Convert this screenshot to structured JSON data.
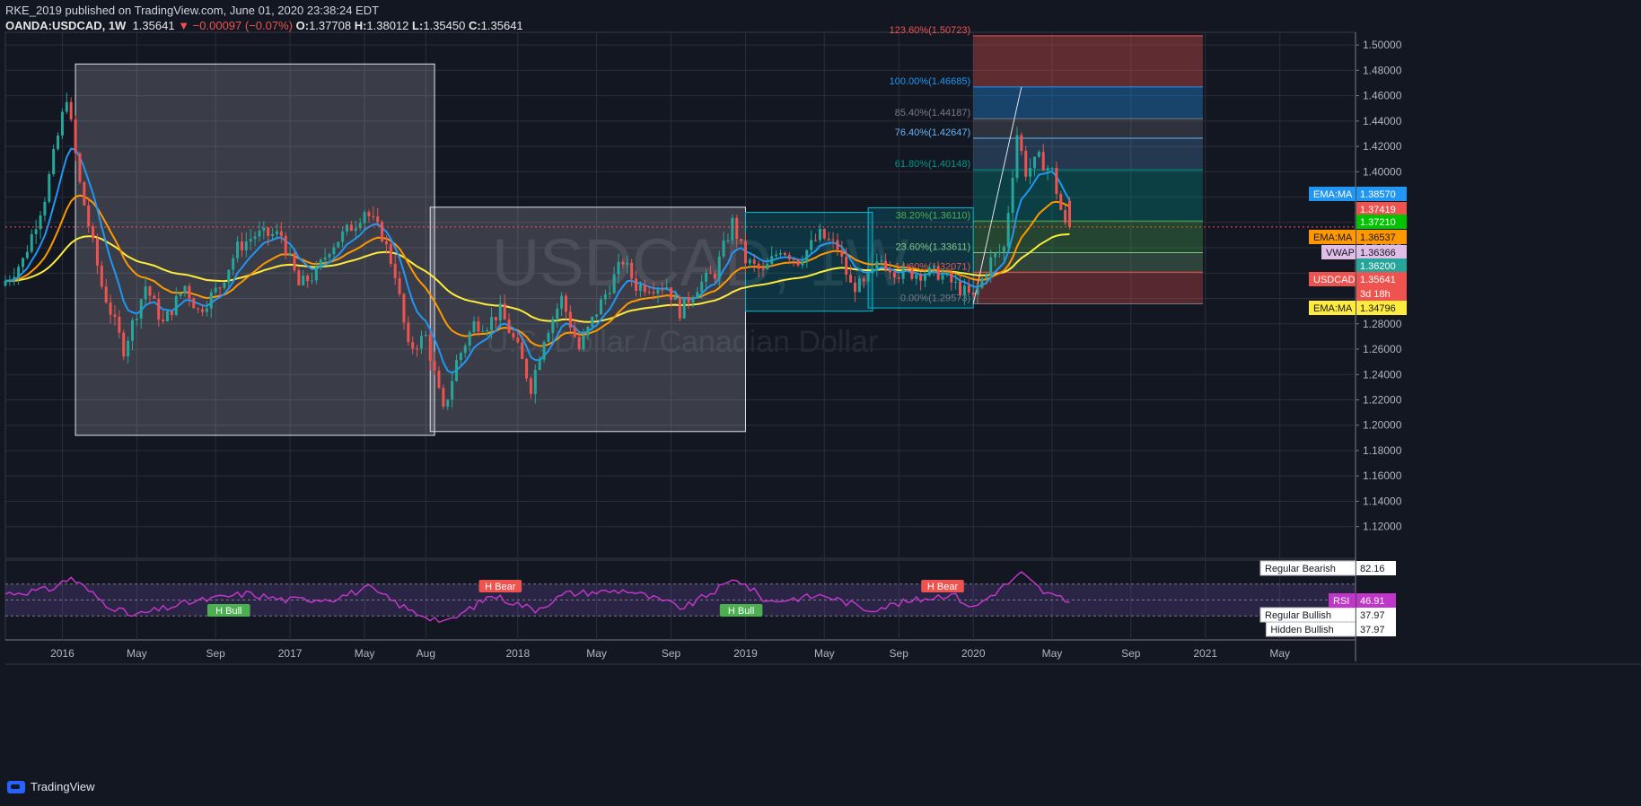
{
  "header": {
    "line1_user": "RKE_2019",
    "line1_rest": " published on TradingView.com, June 01, 2020 23:38:24 EDT",
    "symbol": "OANDA:USDCAD, 1W",
    "last": "1.35641",
    "change": "▼ −0.00097 (−0.07%)",
    "o_label": "O:",
    "o": "1.37708",
    "h_label": "H:",
    "h": "1.38012",
    "l_label": "L:",
    "l": "1.35450",
    "c_label": "C:",
    "c": "1.35641"
  },
  "brand": "TradingView",
  "watermark": {
    "symbol": "USDCAD, 1W",
    "name": "U.S. Dollar / Canadian Dollar"
  },
  "colors": {
    "background": "#131722",
    "grid": "#2a2e39",
    "up": "#26a69a",
    "down": "#ef5350",
    "ema_fast": "#2196f3",
    "ema_mid": "#ff9800",
    "ema_slow": "#ffeb3b",
    "rsi": "#c036c9"
  },
  "chart_data": {
    "type": "candlestick",
    "symbol": "OANDA:USDCAD",
    "interval": "1W",
    "ylim": [
      1.095,
      1.51
    ],
    "y_ticks": [
      "1.50000",
      "1.48000",
      "1.46000",
      "1.44000",
      "1.42000",
      "1.40000",
      "1.38000",
      "1.36000",
      "1.34000",
      "1.32000",
      "1.30000",
      "1.28000",
      "1.26000",
      "1.24000",
      "1.22000",
      "1.20000",
      "1.18000",
      "1.16000",
      "1.14000",
      "1.12000"
    ],
    "x_ticks": [
      "2016",
      "May",
      "Sep",
      "2017",
      "May",
      "Aug",
      "2018",
      "May",
      "Sep",
      "2019",
      "May",
      "Sep",
      "2020",
      "May",
      "Sep",
      "2021",
      "May"
    ],
    "price_path": [
      [
        "2015-10-05",
        1.31
      ],
      [
        "2015-11-09",
        1.33
      ],
      [
        "2015-12-14",
        1.38
      ],
      [
        "2016-01-18",
        1.46
      ],
      [
        "2016-02-08",
        1.39
      ],
      [
        "2016-03-14",
        1.31
      ],
      [
        "2016-04-18",
        1.26
      ],
      [
        "2016-05-23",
        1.31
      ],
      [
        "2016-06-20",
        1.28
      ],
      [
        "2016-07-25",
        1.31
      ],
      [
        "2016-08-15",
        1.29
      ],
      [
        "2016-09-19",
        1.31
      ],
      [
        "2016-10-17",
        1.34
      ],
      [
        "2016-11-14",
        1.35
      ],
      [
        "2016-12-26",
        1.35
      ],
      [
        "2017-01-23",
        1.31
      ],
      [
        "2017-02-20",
        1.32
      ],
      [
        "2017-03-13",
        1.34
      ],
      [
        "2017-04-24",
        1.36
      ],
      [
        "2017-05-08",
        1.37
      ],
      [
        "2017-06-05",
        1.35
      ],
      [
        "2017-06-26",
        1.32
      ],
      [
        "2017-07-17",
        1.26
      ],
      [
        "2017-08-14",
        1.27
      ],
      [
        "2017-09-11",
        1.21
      ],
      [
        "2017-10-02",
        1.25
      ],
      [
        "2017-10-30",
        1.28
      ],
      [
        "2017-11-20",
        1.28
      ],
      [
        "2017-12-11",
        1.29
      ],
      [
        "2018-01-08",
        1.26
      ],
      [
        "2018-01-29",
        1.23
      ],
      [
        "2018-02-19",
        1.27
      ],
      [
        "2018-03-19",
        1.3
      ],
      [
        "2018-04-16",
        1.26
      ],
      [
        "2018-05-14",
        1.29
      ],
      [
        "2018-06-25",
        1.33
      ],
      [
        "2018-07-16",
        1.31
      ],
      [
        "2018-08-13",
        1.31
      ],
      [
        "2018-09-03",
        1.31
      ],
      [
        "2018-09-24",
        1.29
      ],
      [
        "2018-10-22",
        1.31
      ],
      [
        "2018-11-19",
        1.32
      ],
      [
        "2018-12-17",
        1.36
      ],
      [
        "2019-01-07",
        1.33
      ],
      [
        "2019-02-04",
        1.32
      ],
      [
        "2019-03-04",
        1.34
      ],
      [
        "2019-04-01",
        1.33
      ],
      [
        "2019-05-06",
        1.35
      ],
      [
        "2019-06-03",
        1.34
      ],
      [
        "2019-06-24",
        1.31
      ],
      [
        "2019-07-15",
        1.31
      ],
      [
        "2019-08-12",
        1.33
      ],
      [
        "2019-09-09",
        1.32
      ],
      [
        "2019-10-14",
        1.32
      ],
      [
        "2019-11-11",
        1.32
      ],
      [
        "2019-12-09",
        1.31
      ],
      [
        "2020-01-06",
        1.3
      ],
      [
        "2020-02-03",
        1.33
      ],
      [
        "2020-02-24",
        1.34
      ],
      [
        "2020-03-16",
        1.43
      ],
      [
        "2020-03-30",
        1.4
      ],
      [
        "2020-04-20",
        1.41
      ],
      [
        "2020-05-11",
        1.4
      ],
      [
        "2020-05-25",
        1.37
      ],
      [
        "2020-06-01",
        1.3564
      ]
    ],
    "rsi_path": [
      [
        "2015-10-05",
        58
      ],
      [
        "2015-12-14",
        63
      ],
      [
        "2016-01-18",
        78
      ],
      [
        "2016-03-14",
        45
      ],
      [
        "2016-04-25",
        30
      ],
      [
        "2016-07-25",
        47
      ],
      [
        "2016-10-24",
        58
      ],
      [
        "2016-12-26",
        50
      ],
      [
        "2017-03-13",
        52
      ],
      [
        "2017-05-08",
        65
      ],
      [
        "2017-07-17",
        35
      ],
      [
        "2017-09-11",
        22
      ],
      [
        "2017-11-20",
        56
      ],
      [
        "2018-01-29",
        38
      ],
      [
        "2018-03-19",
        58
      ],
      [
        "2018-06-25",
        62
      ],
      [
        "2018-09-24",
        40
      ],
      [
        "2018-12-17",
        77
      ],
      [
        "2019-02-04",
        48
      ],
      [
        "2019-05-06",
        56
      ],
      [
        "2019-07-15",
        38
      ],
      [
        "2019-10-14",
        52
      ],
      [
        "2019-11-25",
        58
      ],
      [
        "2019-12-30",
        40
      ],
      [
        "2020-03-16",
        83
      ],
      [
        "2020-04-20",
        60
      ],
      [
        "2020-06-01",
        46.91
      ]
    ],
    "ema_fast_last": 1.3857,
    "ema_mid_last": 1.36537,
    "ema_slow_last": 1.34796,
    "series": [
      {
        "name": "EMA:MA",
        "value": "1.38570"
      },
      {
        "name": "EMA:MA",
        "value": "1.36537"
      },
      {
        "name": "EMA:MA",
        "value": "1.34796"
      },
      {
        "name": "VWAP",
        "value": "1.36366"
      },
      {
        "name": "USDCAD",
        "value": "1.35641"
      }
    ],
    "price_tags": [
      {
        "text": "EMA:MA",
        "value": "1.38570",
        "bg": "#2196f3",
        "fg": "#ffffff",
        "price": 1.3857
      },
      {
        "text": "",
        "value": "1.37419",
        "bg": "#ef5350",
        "fg": "#ffffff",
        "price": 1.3742
      },
      {
        "text": "",
        "value": "1.37210",
        "bg": "#00c400",
        "fg": "#ffffff",
        "price": 1.3721
      },
      {
        "text": "EMA:MA",
        "value": "1.36537",
        "bg": "#ff9800",
        "fg": "#131722",
        "price": 1.3654
      },
      {
        "text": "VWAP",
        "value": "1.36366",
        "bg": "#e1bee7",
        "fg": "#131722",
        "price": 1.3637
      },
      {
        "text": "",
        "value": "1.36200",
        "bg": "#26a69a",
        "fg": "#ffffff",
        "price": 1.362
      },
      {
        "text": "USDCAD",
        "value": "1.35641",
        "bg": "#ef5350",
        "fg": "#ffffff",
        "price": 1.3564
      },
      {
        "text": "",
        "value": "3d 18h",
        "bg": "#ef5350",
        "fg": "#ffffff",
        "price": 1.3508
      },
      {
        "text": "EMA:MA",
        "value": "1.34796",
        "bg": "#ffeb3b",
        "fg": "#131722",
        "price": 1.348
      }
    ],
    "fib": {
      "start": "2019-12-30",
      "end": "2020-12-31",
      "levels": [
        {
          "label": "123.60%(1.50723)",
          "price": 1.50723,
          "color": "#ef5350"
        },
        {
          "label": "100.00%(1.46685)",
          "price": 1.46685,
          "color": "#2196f3"
        },
        {
          "label": "85.40%(1.44187)",
          "price": 1.44187,
          "color": "#787b86"
        },
        {
          "label": "76.40%(1.42647)",
          "price": 1.42647,
          "color": "#64b5f6"
        },
        {
          "label": "61.80%(1.40148)",
          "price": 1.40148,
          "color": "#009688"
        },
        {
          "label": "38.20%(1.36110)",
          "price": 1.3611,
          "color": "#4caf50"
        },
        {
          "label": "23.60%(1.33611)",
          "price": 1.33611,
          "color": "#81c784"
        },
        {
          "label": "14.60%(1.32071)",
          "price": 1.32071,
          "color": "#ef5350"
        },
        {
          "label": "0.00%(1.29573)",
          "price": 1.29573,
          "color": "#787b86"
        }
      ]
    },
    "rsi_labels": {
      "rsi": "RSI",
      "value": "46.91"
    },
    "rsi_tags": [
      {
        "text": "Regular Bearish",
        "value": "82.16"
      },
      {
        "text": "Regular Bullish",
        "value": "37.97"
      },
      {
        "text": "Hidden Bullish",
        "value": "37.97"
      }
    ],
    "div_labels": [
      {
        "text": "H Bull",
        "date": "2016-09-26",
        "rsi": 30,
        "kind": "bull"
      },
      {
        "text": "H Bear",
        "date": "2017-12-04",
        "rsi": 70,
        "kind": "bear"
      },
      {
        "text": "H Bull",
        "date": "2018-12-24",
        "rsi": 30,
        "kind": "bull"
      },
      {
        "text": "H Bear",
        "date": "2019-11-11",
        "rsi": 70,
        "kind": "bear"
      }
    ]
  }
}
